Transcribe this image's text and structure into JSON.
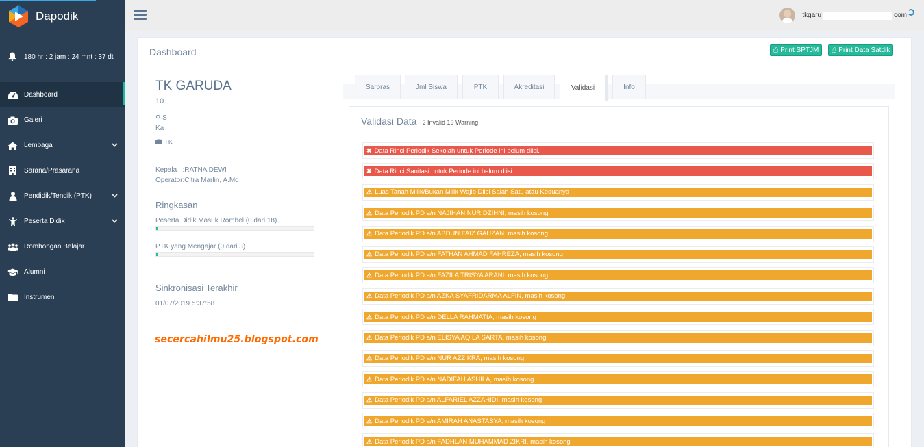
{
  "app": {
    "name": "Dapodik"
  },
  "sidebar": {
    "countdown": "180 hr : 2 jam : 24 mnt : 37 dt",
    "items": [
      {
        "label": "Dashboard",
        "icon": "dashboard-icon",
        "active": true
      },
      {
        "label": "Galeri",
        "icon": "camera-icon"
      },
      {
        "label": "Lembaga",
        "icon": "home-icon",
        "chevron": true
      },
      {
        "label": "Sarana/Prasarana",
        "icon": "building-icon"
      },
      {
        "label": "Pendidik/Tendik (PTK)",
        "icon": "user-icon",
        "chevron": true
      },
      {
        "label": "Peserta Didik",
        "icon": "child-icon",
        "chevron": true
      },
      {
        "label": "Rombongan Belajar",
        "icon": "users-icon"
      },
      {
        "label": "Alumni",
        "icon": "graduation-cap-icon"
      },
      {
        "label": "Instrumen",
        "icon": "folder-icon"
      }
    ]
  },
  "topbar": {
    "user_prefix": "tkgaru",
    "user_suffix": "com"
  },
  "page": {
    "title": "Dashboard",
    "print_sptjm": "Print SPTJM",
    "print_satdik": "Print Data Satdik"
  },
  "profile": {
    "school_name": "TK GARUDA",
    "npsn": "10",
    "address_line1": "S",
    "address_line2": "Ka",
    "jenjang": "TK",
    "kepala": "Kepala   :RATNA DEWI",
    "operator": "Operator:Citra Marlin, A.Md",
    "ringkasan_title": "Ringkasan",
    "rombel_label": "Peserta Didik Masuk Rombel (0 dari 18)",
    "rombel_progress": 0,
    "ptk_label": "PTK yang Mengajar (0 dari 3)",
    "ptk_progress": 0,
    "sync_title": "Sinkronisasi Terakhir",
    "sync_date": "01/07/2019 5:37:58",
    "watermark": "secercahilmu25.blogspot.com"
  },
  "tabs": [
    {
      "label": "Sarpras"
    },
    {
      "label": "Jml Siswa"
    },
    {
      "label": "PTK"
    },
    {
      "label": "Akreditasi"
    },
    {
      "label": "Validasi",
      "active": true
    },
    {
      "label": "Info"
    }
  ],
  "validasi": {
    "title": "Validasi Data",
    "summary": "2 Invalid 19 Warning",
    "colors": {
      "invalid": "#e9594b",
      "warning": "#f0a72e"
    },
    "alerts": [
      {
        "type": "invalid",
        "text": "Data Rinci Periodik Sekolah untuk Periode ini belum diisi."
      },
      {
        "type": "invalid",
        "text": "Data Rinci Sanitasi untuk Periode ini belum diisi."
      },
      {
        "type": "warning",
        "text": "Luas Tanah Milik/Bukan Milik Wajib Diisi Salah Satu atau Keduanya"
      },
      {
        "type": "warning",
        "text": "Data Periodik PD a/n NAJIHAN NUR DZIHNI, masih kosong"
      },
      {
        "type": "warning",
        "text": "Data Periodik PD a/n ABDUN FAIZ GAUZAN, masih kosong"
      },
      {
        "type": "warning",
        "text": "Data Periodik PD a/n FATHAN AHMAD FAHREZA, masih kosong"
      },
      {
        "type": "warning",
        "text": "Data Periodik PD a/n FAZILA TRISYA ARANI, masih kosong"
      },
      {
        "type": "warning",
        "text": "Data Periodik PD a/n AZKA SYAFRIDARMA ALFIN, masih kosong"
      },
      {
        "type": "warning",
        "text": "Data Periodik PD a/n DELLA RAHMATIA, masih kosong"
      },
      {
        "type": "warning",
        "text": "Data Periodik PD a/n ELISYA AQILA SARTA, masih kosong"
      },
      {
        "type": "warning",
        "text": "Data Periodik PD a/n NUR AZZIKRA, masih kosong"
      },
      {
        "type": "warning",
        "text": "Data Periodik PD a/n NADIFAH ASHILA, masih kosong"
      },
      {
        "type": "warning",
        "text": "Data Periodik PD a/n ALFARIEL AZZAHIDI, masih kosong"
      },
      {
        "type": "warning",
        "text": "Data Periodik PD a/n AMIRAH ANASTASYA, masih kosong"
      },
      {
        "type": "warning",
        "text": "Data Periodik PD a/n FADHLAN MUHAMMAD ZIKRI, masih kosong"
      }
    ]
  }
}
